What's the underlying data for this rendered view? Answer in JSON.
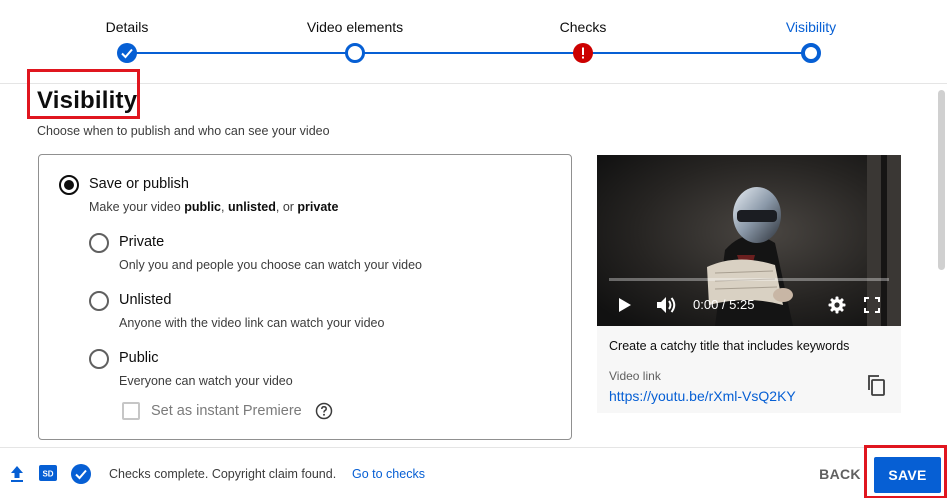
{
  "stepper": {
    "steps": [
      {
        "label": "Details",
        "state": "done"
      },
      {
        "label": "Video elements",
        "state": "open"
      },
      {
        "label": "Checks",
        "state": "error"
      },
      {
        "label": "Visibility",
        "state": "active"
      }
    ]
  },
  "visibility": {
    "title": "Visibility",
    "subtitle": "Choose when to publish and who can see your video",
    "save_or_publish": {
      "label": "Save or publish",
      "desc_prefix": "Make your video ",
      "desc_public": "public",
      "desc_sep1": ", ",
      "desc_unlisted": "unlisted",
      "desc_sep2": ", or ",
      "desc_private": "private"
    },
    "options": [
      {
        "label": "Private",
        "desc": "Only you and people you choose can watch your video"
      },
      {
        "label": "Unlisted",
        "desc": "Anyone with the video link can watch your video"
      },
      {
        "label": "Public",
        "desc": "Everyone can watch your video"
      }
    ],
    "premiere_label": "Set as instant Premiere"
  },
  "preview": {
    "time": "0:00 / 5:25",
    "title_hint": "Create a catchy title that includes keywords",
    "link_label": "Video link",
    "link_value": "https://youtu.be/rXml-VsQ2KY"
  },
  "footer": {
    "status": "Checks complete. Copyright claim found.",
    "goto_checks": "Go to checks",
    "back": "BACK",
    "save": "SAVE"
  },
  "colors": {
    "accent": "#065fd4",
    "error": "#cc0000",
    "highlight_box": "#e0161f"
  },
  "icons": [
    "checkmark-icon",
    "exclamation-icon",
    "play-icon",
    "volume-icon",
    "gear-icon",
    "fullscreen-icon",
    "copy-icon",
    "help-icon",
    "upload-icon",
    "hd-icon",
    "check-circle-icon"
  ]
}
